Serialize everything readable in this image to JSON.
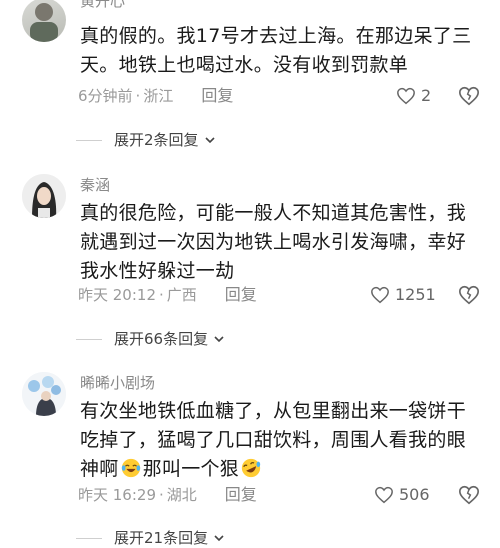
{
  "comments": [
    {
      "username": "黄开心",
      "text": "真的假的。我17号才去过上海。在那边呆了三天。地铁上也喝过水。没有收到罚款单",
      "time": "6分钟前",
      "location": "浙江",
      "reply_label": "回复",
      "likes": "2",
      "expand_label": "展开2条回复"
    },
    {
      "username": "秦涵",
      "text": "真的很危险，可能一般人不知道其危害性，我就遇到过一次因为地铁上喝水引发海啸，幸好我水性好躲过一劫",
      "time": "昨天 20:12",
      "location": "广西",
      "reply_label": "回复",
      "likes": "1251",
      "expand_label": "展开66条回复"
    },
    {
      "username": "晞晞小剧场",
      "text_part1": "有次坐地铁低血糖了，从包里翻出来一袋饼干吃掉了，猛喝了几口甜饮料，周围人看我的眼神啊",
      "text_part2": "那叫一个狠",
      "emoji1": "laugh-cry-emoji",
      "emoji2": "rolling-laugh-emoji",
      "time": "昨天 16:29",
      "location": "湖北",
      "reply_label": "回复",
      "likes": "506",
      "expand_label": "展开21条回复"
    }
  ],
  "separator": "·",
  "colors": {
    "accent_text": "#1a1a1a",
    "meta": "#9a9a9a"
  }
}
